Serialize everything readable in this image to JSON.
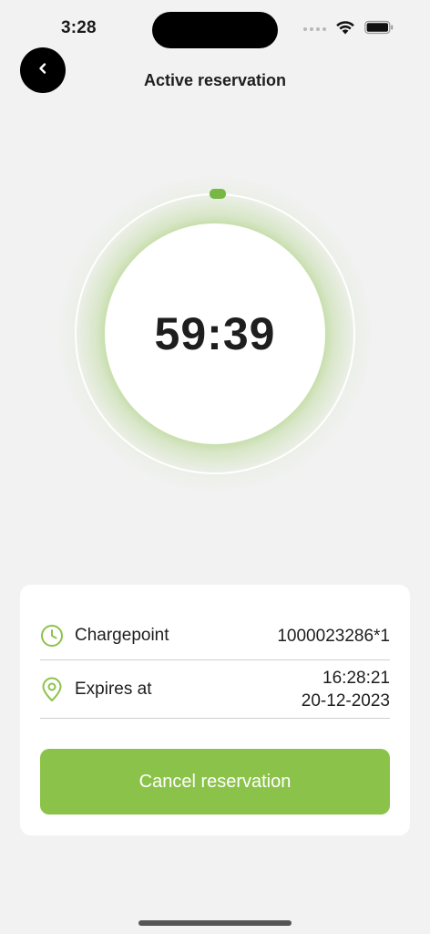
{
  "status_bar": {
    "time": "3:28"
  },
  "header": {
    "title": "Active reservation",
    "back_icon": "chevron-left-icon"
  },
  "timer": {
    "remaining": "59:39",
    "accent_color": "#8bc34a"
  },
  "details": {
    "chargepoint": {
      "icon": "clock-icon",
      "label": "Chargepoint",
      "value": "1000023286*1"
    },
    "expires": {
      "icon": "location-pin-icon",
      "label": "Expires at",
      "time": "16:28:21",
      "date": "20-12-2023"
    }
  },
  "actions": {
    "cancel_label": "Cancel reservation",
    "cancel_color": "#8bc34a"
  }
}
